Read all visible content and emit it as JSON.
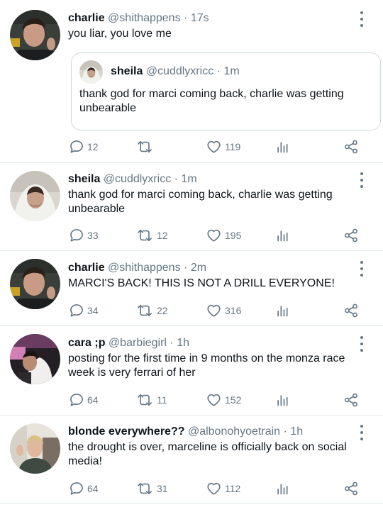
{
  "tweets": [
    {
      "name": "charlie",
      "handle": "@shithappens",
      "time": "17s",
      "text": "you liar, you love me",
      "quote": {
        "name": "sheila",
        "handle": "@cuddlyxricc",
        "time": "1m",
        "text": "thank god for marci coming back, charlie was getting unbearable"
      },
      "replies": "12",
      "retweets": "",
      "likes": "119"
    },
    {
      "name": "sheila",
      "handle": "@cuddlyxricc",
      "time": "1m",
      "text": "thank god for marci coming back, charlie was getting unbearable",
      "replies": "33",
      "retweets": "12",
      "likes": "195"
    },
    {
      "name": "charlie",
      "handle": "@shithappens",
      "time": "2m",
      "text": "MARCI'S BACK! THIS IS NOT A DRILL EVERYONE!",
      "replies": "34",
      "retweets": "22",
      "likes": "316"
    },
    {
      "name": "cara ;p",
      "handle": "@barbiegirl",
      "time": "1h",
      "text": "posting for the first time in 9 months on the monza race week is very ferrari of her",
      "replies": "64",
      "retweets": "11",
      "likes": "152"
    },
    {
      "name": "blonde everywhere??",
      "handle": "@albonohyoetrain",
      "time": "1h",
      "text": "the drought is over, marceline is officially back on social media!",
      "replies": "64",
      "retweets": "31",
      "likes": "112"
    }
  ],
  "separator": "·",
  "colors": {
    "text": "#0f1419",
    "secondary": "#657786",
    "border": "#e1e8ed"
  },
  "icons": [
    "reply-icon",
    "retweet-icon",
    "like-icon",
    "stats-icon",
    "share-icon",
    "more-icon"
  ]
}
